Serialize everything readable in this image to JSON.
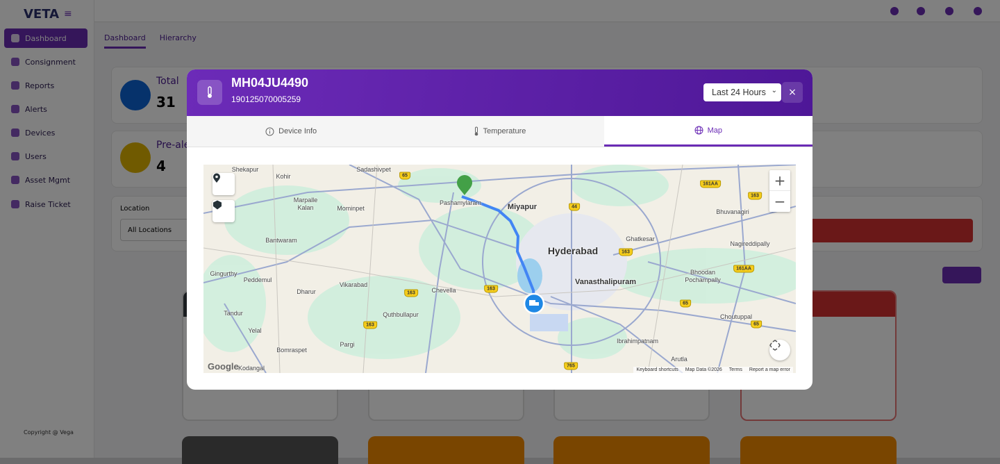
{
  "app": {
    "logo": "VETA",
    "copyright": "Copyright @ Vega"
  },
  "sidebar": {
    "items": [
      {
        "label": "Dashboard"
      },
      {
        "label": "Consignment"
      },
      {
        "label": "Reports"
      },
      {
        "label": "Alerts"
      },
      {
        "label": "Devices"
      },
      {
        "label": "Users"
      },
      {
        "label": "Asset Mgmt"
      },
      {
        "label": "Raise Ticket"
      }
    ]
  },
  "main": {
    "tabs": [
      "Dashboard",
      "Hierarchy"
    ],
    "total_label": "Total",
    "total_value": "31",
    "prealert_label": "Pre-alert",
    "prealert_value": "4",
    "location_label": "Location",
    "location_value": "All Locations"
  },
  "modal": {
    "title": "MH04JU4490",
    "subtitle": "190125070005259",
    "range_select": "Last 24 Hours",
    "close": "×",
    "tabs": [
      {
        "label": "Device Info",
        "icon": "info-icon"
      },
      {
        "label": "Temperature",
        "icon": "thermometer-icon"
      },
      {
        "label": "Map",
        "icon": "globe-icon"
      }
    ],
    "active_tab": "Map"
  },
  "map": {
    "labels": [
      "Shekapur",
      "Kohir",
      "Marpalle Kalan",
      "Mominpet",
      "Sadashivpet",
      "Pashamylaram",
      "Miyapur",
      "Hyderabad",
      "Bantwaram",
      "Gingurthy",
      "Peddemul",
      "Dharur",
      "Vikarabad",
      "Chevella",
      "Quthbullapur",
      "Tandur",
      "Yelal",
      "Bomraspet",
      "Pargi",
      "Kodangal",
      "Ghatkesar",
      "Bhuvanagiri",
      "Nagireddipally",
      "Vanasthalipuram",
      "Bhoodan Pochampally",
      "Choutuppal",
      "Ibrahimpatnam",
      "Arutla"
    ],
    "shields": [
      "65",
      "163",
      "163",
      "163",
      "44",
      "163",
      "161AA",
      "163",
      "161AA",
      "65",
      "65",
      "765"
    ],
    "zoom_in": "+",
    "zoom_out": "−",
    "google": "Google",
    "attribution": [
      "Keyboard shortcuts",
      "Map Data ©2026",
      "Terms",
      "Report a map error"
    ],
    "route_color": "#4285f4"
  }
}
